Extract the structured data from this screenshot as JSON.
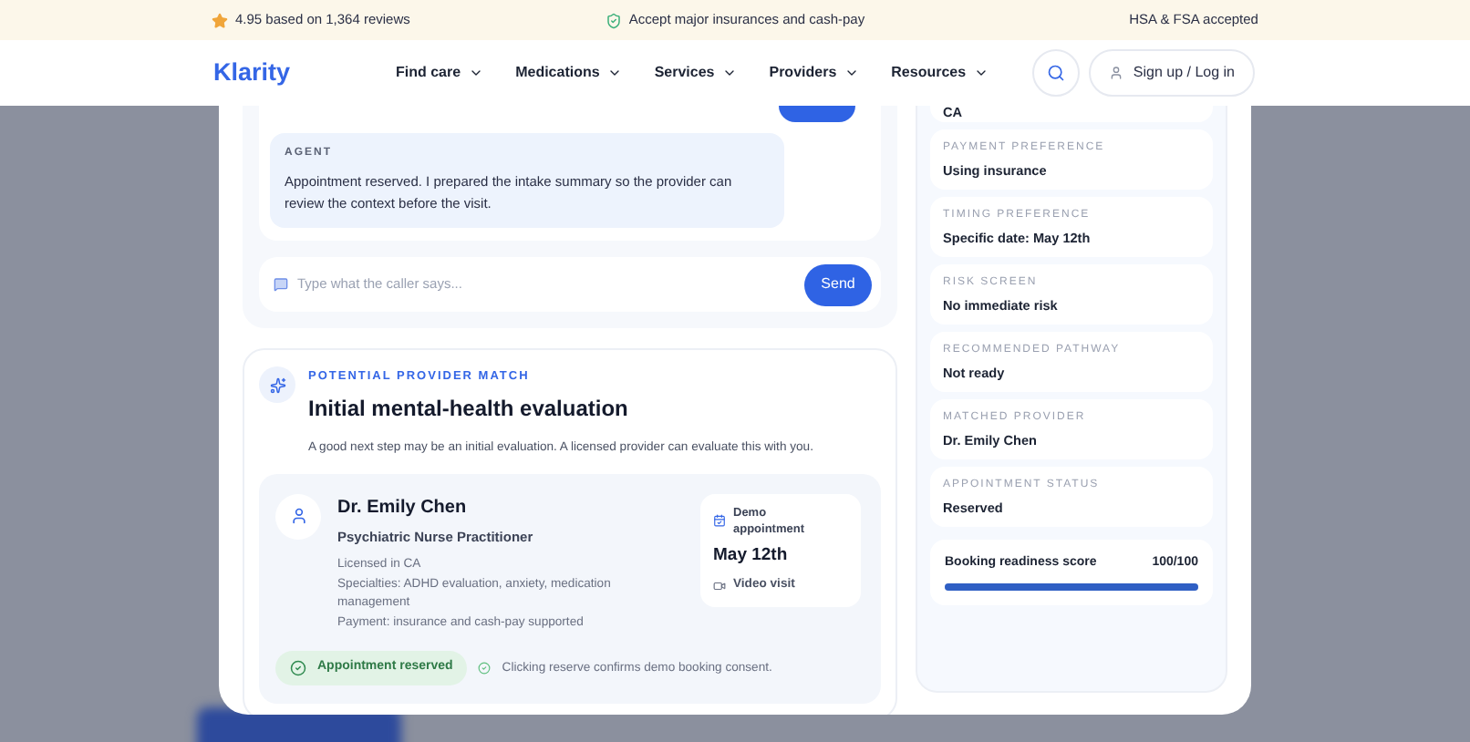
{
  "banner": {
    "rating": "4.95 based on 1,364 reviews",
    "insurance": "Accept major insurances and cash-pay",
    "hsa": "HSA & FSA accepted"
  },
  "nav": {
    "logo": "Klarity",
    "items": [
      "Find care",
      "Medications",
      "Services",
      "Providers",
      "Resources"
    ],
    "login": "Sign up / Log in"
  },
  "chat": {
    "messages": [
      {
        "role": "AGENT",
        "text": "Appointment reserved. I prepared the intake summary so the provider can review the context before the visit."
      }
    ],
    "input": {
      "placeholder": "Type what the caller says..."
    },
    "send": "Send"
  },
  "match": {
    "eyebrow": "POTENTIAL PROVIDER MATCH",
    "title": "Initial mental-health evaluation",
    "description": "A good next step may be an initial evaluation. A licensed provider can evaluate this with you.",
    "provider": {
      "name": "Dr. Emily Chen",
      "role": "Psychiatric Nurse Practitioner",
      "details": [
        "Licensed in CA",
        "Specialties: ADHD evaluation, anxiety, medication management",
        "Payment: insurance and cash-pay supported"
      ]
    },
    "appointment": {
      "label": "Demo appointment",
      "date": "May 12th",
      "mode": "Video visit"
    },
    "status": {
      "label": "Appointment reserved",
      "reserved": true
    },
    "consent": "Clicking reserve confirms demo booking consent."
  },
  "summary": {
    "items": [
      {
        "value": "CA"
      },
      {
        "label": "PAYMENT PREFERENCE",
        "value": "Using insurance"
      },
      {
        "label": "TIMING PREFERENCE",
        "value": "Specific date: May 12th"
      },
      {
        "label": "RISK SCREEN",
        "value": "No immediate risk"
      },
      {
        "label": "RECOMMENDED PATHWAY",
        "value": "Not ready"
      },
      {
        "label": "MATCHED PROVIDER",
        "value": "Dr. Emily Chen"
      },
      {
        "label": "APPOINTMENT STATUS",
        "value": "Reserved"
      }
    ],
    "score": {
      "label": "Booking readiness score",
      "reading": "100/100",
      "level": 1
    }
  }
}
